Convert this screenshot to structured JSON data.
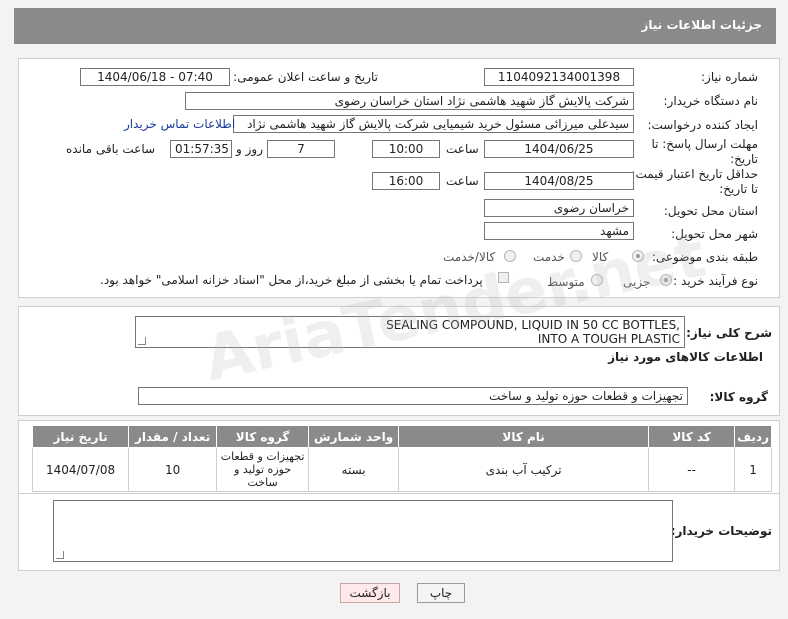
{
  "header": {
    "title": "جزئیات اطلاعات نیاز"
  },
  "fields": {
    "need_number_label": "شماره نیاز:",
    "need_number": "1104092134001398",
    "announce_label": "تاریخ و ساعت اعلان عمومی:",
    "announce_value": "1404/06/18 - 07:40",
    "buyer_org_label": "نام دستگاه خریدار:",
    "buyer_org": "شرکت پالایش گاز شهید هاشمی نژاد   استان خراسان رضوی",
    "requester_label": "ایجاد کننده درخواست:",
    "requester": "سیدعلی میرزائی مسئول خرید شیمیایی شرکت پالایش گاز شهید هاشمی نژاد",
    "contact_link": "اطلاعات تماس خریدار",
    "deadline_label_1": "مهلت ارسال پاسخ: تا",
    "deadline_label_2": "تاریخ:",
    "deadline_date": "1404/06/25",
    "time_label": "ساعت",
    "deadline_time": "10:00",
    "days_value": "7",
    "days_label": "روز و",
    "remaining_time": "01:57:35",
    "remaining_label": "ساعت باقی مانده",
    "validity_label_1": "حداقل تاریخ اعتبار قیمت:",
    "validity_label_2": "تا تاریخ:",
    "validity_date": "1404/08/25",
    "validity_time": "16:00",
    "province_label": "استان محل تحویل:",
    "province": "خراسان رضوی",
    "city_label": "شهر محل تحویل:",
    "city": "مشهد",
    "category_label": "طبقه بندی موضوعی:",
    "category_options": [
      "کالا",
      "خدمت",
      "کالا/خدمت"
    ],
    "process_label": "نوع فرآیند خرید :",
    "process_options": [
      "جزیی",
      "متوسط"
    ],
    "payment_note": "پرداخت تمام یا بخشی از مبلغ خرید،از محل \"اسناد خزانه اسلامی\" خواهد بود."
  },
  "description": {
    "label": "شرح کلی نیاز:",
    "line1": "SEALING COMPOUND, LIQUID IN 50 CC BOTTLES,",
    "line2": "INTO A TOUGH PLASTIC"
  },
  "goods": {
    "section_title": "اطلاعات کالاهای مورد نیاز",
    "group_label": "گروه کالا:",
    "group_value": "تجهیزات و قطعات حوزه تولید و ساخت",
    "columns": [
      "ردیف",
      "کد کالا",
      "نام کالا",
      "واحد شمارش",
      "گروه کالا",
      "تعداد / مقدار",
      "تاریخ نیاز"
    ],
    "rows": [
      {
        "row": "1",
        "code": "--",
        "name": "ترکیب آب بندی",
        "unit": "بسته",
        "group": "تجهیزات و قطعات حوزه تولید و ساخت",
        "qty": "10",
        "date": "1404/07/08"
      }
    ]
  },
  "buyer_notes": {
    "label": "توضیحات خریدار:"
  },
  "buttons": {
    "print": "چاپ",
    "back": "بازگشت"
  },
  "watermark": "AriaTender.net"
}
